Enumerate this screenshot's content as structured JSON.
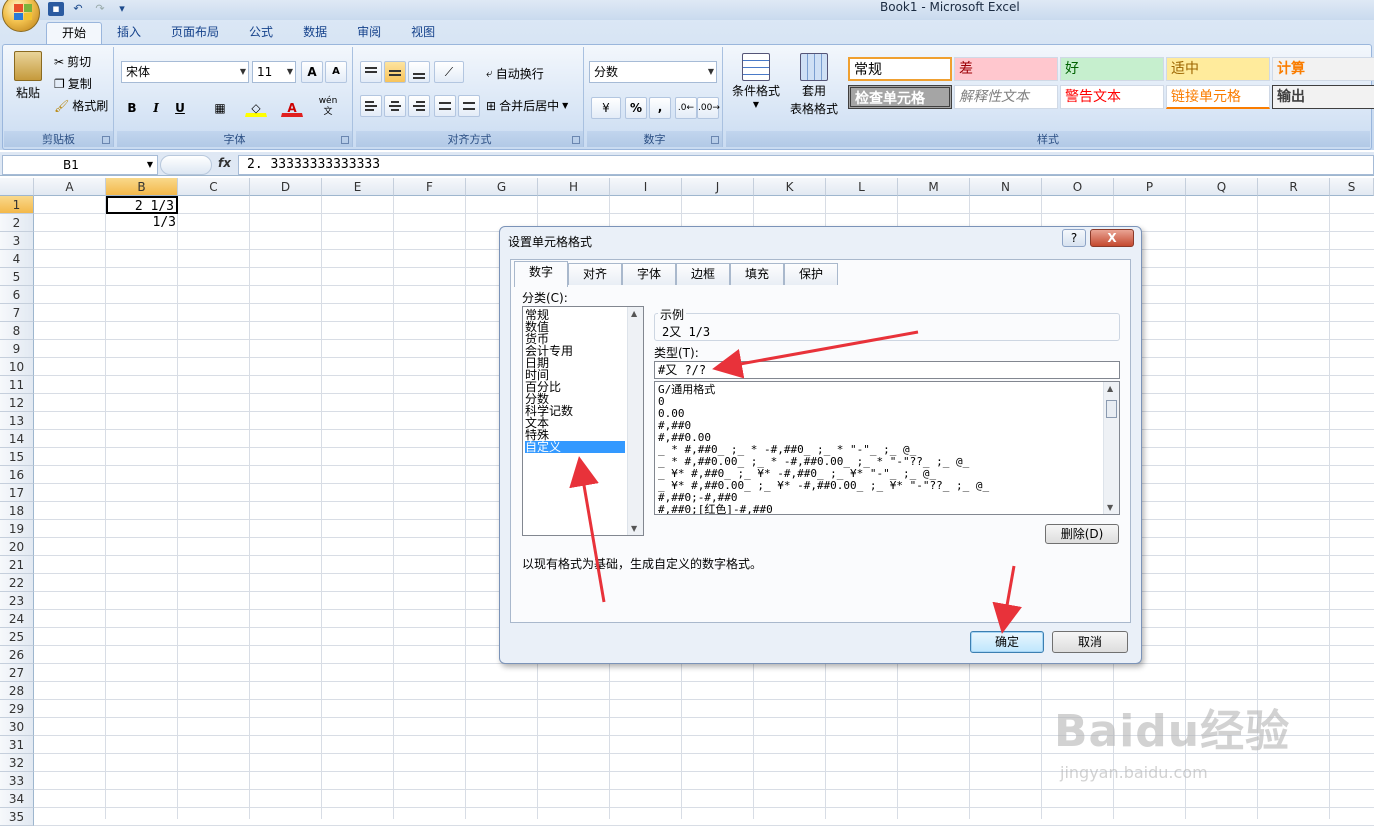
{
  "app": {
    "window_title": "Book1 - Microsoft Excel"
  },
  "ribbon": {
    "tabs": [
      "开始",
      "插入",
      "页面布局",
      "公式",
      "数据",
      "审阅",
      "视图"
    ],
    "clipboard": {
      "paste": "粘贴",
      "cut": "剪切",
      "copy": "复制",
      "format_painter": "格式刷",
      "group": "剪贴板"
    },
    "font": {
      "name": "宋体",
      "size": "11",
      "bold": "B",
      "italic": "I",
      "underline": "U",
      "font_color_glyph": "A",
      "phonetic_glyph": "wén 文",
      "group": "字体"
    },
    "alignment": {
      "wrap": "自动换行",
      "merge": "合并后居中",
      "group": "对齐方式"
    },
    "number": {
      "format": "分数",
      "percent": "%",
      "comma": ",",
      "group": "数字"
    },
    "styles": {
      "conditional": "条件格式",
      "table_format_1": "套用",
      "table_format_2": "表格格式",
      "group": "样式",
      "cells": [
        {
          "label": "常规",
          "bg": "#ffffff",
          "fg": "#000000"
        },
        {
          "label": "差",
          "bg": "#ffc7ce",
          "fg": "#9c0006"
        },
        {
          "label": "好",
          "bg": "#c6efce",
          "fg": "#006100"
        },
        {
          "label": "适中",
          "bg": "#ffeb9c",
          "fg": "#9c6500"
        },
        {
          "label": "计算",
          "bg": "#f2f2f2",
          "fg": "#fa7d00"
        },
        {
          "label": "检查单元格",
          "bg": "#a5a5a5",
          "fg": "#ffffff"
        },
        {
          "label": "解释性文本",
          "bg": "#ffffff",
          "fg": "#7f7f7f"
        },
        {
          "label": "警告文本",
          "bg": "#ffffff",
          "fg": "#ff0000"
        },
        {
          "label": "链接单元格",
          "bg": "#ffffff",
          "fg": "#fa7d00"
        },
        {
          "label": "输出",
          "bg": "#f2f2f2",
          "fg": "#3f3f3f"
        }
      ]
    }
  },
  "formula_bar": {
    "name_box": "B1",
    "fx": "fx",
    "value": "2. 33333333333333"
  },
  "sheet": {
    "columns": [
      "A",
      "B",
      "C",
      "D",
      "E",
      "F",
      "G",
      "H",
      "I",
      "J",
      "K",
      "L",
      "M",
      "N",
      "O",
      "P",
      "Q",
      "R",
      "S"
    ],
    "rows": [
      "1",
      "2",
      "3",
      "4",
      "5",
      "6",
      "7",
      "8",
      "9",
      "10",
      "11",
      "12",
      "13",
      "14",
      "15",
      "16",
      "17",
      "18",
      "19",
      "20",
      "21",
      "22",
      "23",
      "24",
      "25",
      "26",
      "27",
      "28",
      "29",
      "30",
      "31",
      "32",
      "33",
      "34",
      "35"
    ],
    "cells": {
      "B1": "2 1/3",
      "B2": "1/3"
    },
    "active_cell": "B1"
  },
  "dialog": {
    "title": "设置单元格格式",
    "help": "?",
    "close": "X",
    "tabs": [
      "数字",
      "对齐",
      "字体",
      "边框",
      "填充",
      "保护"
    ],
    "category_label": "分类(C):",
    "categories": [
      "常规",
      "数值",
      "货币",
      "会计专用",
      "日期",
      "时间",
      "百分比",
      "分数",
      "科学记数",
      "文本",
      "特殊",
      "自定义"
    ],
    "selected_category": "自定义",
    "sample_label": "示例",
    "sample_value": "2又 1/3",
    "type_label": "类型(T):",
    "type_value": "#又 ?/?",
    "type_list": [
      "G/通用格式",
      "0",
      "0.00",
      "#,##0",
      "#,##0.00",
      "_ * #,##0_ ;_ * -#,##0_ ;_ * \"-\"_ ;_ @_",
      "_ * #,##0.00_ ;_ * -#,##0.00_ ;_ * \"-\"??_ ;_ @_",
      "_ ¥* #,##0_ ;_ ¥* -#,##0_ ;_ ¥* \"-\"_ ;_ @_",
      "_ ¥* #,##0.00_ ;_ ¥* -#,##0.00_ ;_ ¥* \"-\"??_ ;_ @_",
      "#,##0;-#,##0",
      "#,##0;[红色]-#,##0"
    ],
    "delete_button": "删除(D)",
    "description": "以现有格式为基础，生成自定义的数字格式。",
    "ok_button": "确定",
    "cancel_button": "取消"
  },
  "watermark": {
    "logo": "Baidu经验",
    "url": "jingyan.baidu.com"
  }
}
